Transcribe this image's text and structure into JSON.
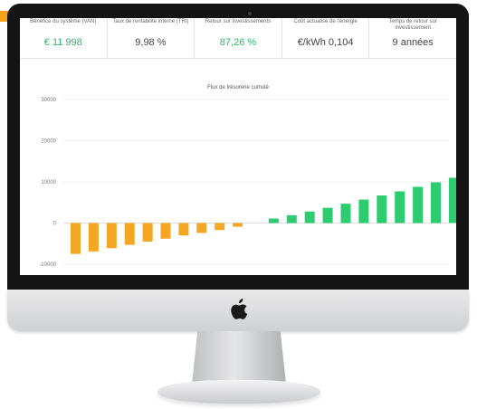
{
  "kpis": [
    {
      "label": "Bénéfice du système (VAN)",
      "value": "€ 11 998",
      "highlight": true
    },
    {
      "label": "Taux de rentabilité interne (TRI)",
      "value": "9,98 %",
      "highlight": false
    },
    {
      "label": "Retour sur investissements",
      "value": "87,26 %",
      "highlight": true
    },
    {
      "label": "Coût actualisé de l'énergie",
      "value": "€/kWh 0,104",
      "highlight": false
    },
    {
      "label": "Temps de retour sur investissement",
      "value": "9 années",
      "highlight": false
    }
  ],
  "colors": {
    "negative": "#f5a623",
    "positive": "#2ecc71",
    "value_green": "#29b86a"
  },
  "chart_data": {
    "type": "bar",
    "title": "Flux de trésorerie cumulé",
    "yticks": [
      "30000",
      "20000",
      "10000",
      "0",
      "-10000"
    ],
    "ylim": [
      -10000,
      30000
    ],
    "grid": true,
    "values": [
      -7500,
      -6900,
      -6100,
      -5300,
      -4500,
      -3800,
      -3000,
      -2400,
      -1700,
      -900,
      0,
      1100,
      1900,
      2800,
      3700,
      4700,
      5700,
      6700,
      7700,
      8800,
      9900,
      11000
    ]
  }
}
